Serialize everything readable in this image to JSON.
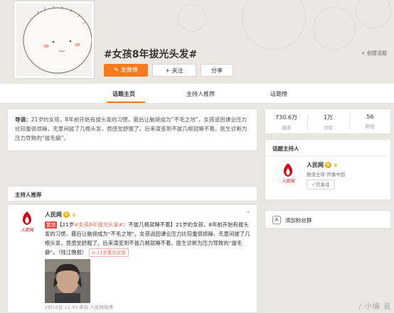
{
  "header": {
    "topic_title": "#女孩8年拔光头发#",
    "post_button": "发微博",
    "follow_button": "+ 关注",
    "share_button": "分享",
    "create_link": "+ 创建话题"
  },
  "tabs": [
    {
      "label": "话题主页"
    },
    {
      "label": "主持人推荐"
    },
    {
      "label": "话题榜"
    }
  ],
  "intro": {
    "label": "导语：",
    "text": "21岁的女孩，8年前开始有拔头发的习惯，最后让脑袋成为“不毛之地”。女孩说因课业压力比较重很烦躁，无意间拔了几根头发，竟感觉舒服了。后来演变到不拔几根就睡不着。医生诊断为压力导致的“拔毛癖”。"
  },
  "stats": [
    {
      "value": "730.6万",
      "label": "阅读"
    },
    {
      "value": "1万",
      "label": "讨论"
    },
    {
      "value": "56",
      "label": "粉丝"
    }
  ],
  "host": {
    "heading": "话题主持人",
    "name": "人民网",
    "desc": "报道全球 传播中国",
    "followed": "✓已关注"
  },
  "fans_group": {
    "label": "添加粉丝群"
  },
  "recommend": {
    "heading": "主持人推荐"
  },
  "post": {
    "author": "人民网",
    "tag_top": "置顶",
    "text_a": "【21岁",
    "topic": "#女孩8年拔光头发#",
    "text_b": "：不拔几根就睡不着】21岁的女孩，8年前开始有拔头发的习惯，最后让脑袋成为“不毛之地”。女孩说因课业压力比较重很烦躁，无意间拔了几根头发，竟感觉舒服了。后来演变到不拔几根就睡不着。医生诊断为压力导致的“拔毛癖”。（钱江晚报）",
    "chip": "21岁重庆女孩",
    "meta": "2月16日 11:40 来自 人民网微博"
  },
  "logo_text": "人民网",
  "watermark": "/ 小编 说",
  "colors": {
    "accent": "#f67b1e",
    "link": "#eb7350",
    "brand_red": "#d7000f"
  }
}
